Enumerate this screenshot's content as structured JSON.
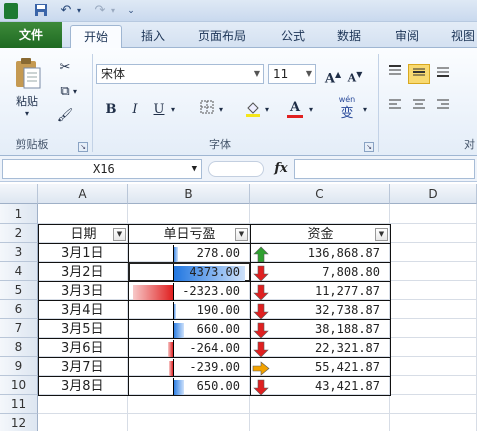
{
  "quick_access": {
    "undo_icon": "undo-icon",
    "redo_icon": "redo-icon",
    "save_icon": "save-icon"
  },
  "tabs": [
    "文件",
    "开始",
    "插入",
    "页面布局",
    "公式",
    "数据",
    "审阅",
    "视图"
  ],
  "ribbon": {
    "clipboard": {
      "paste_label": "粘贴",
      "group_label": "剪贴板"
    },
    "font": {
      "font_name": "宋体",
      "font_size": "11",
      "grow": "A",
      "shrink": "A",
      "bold": "B",
      "italic": "I",
      "underline": "U",
      "wen": "wén",
      "group_label": "字体"
    },
    "alignment": {
      "group_label": "对"
    }
  },
  "formula_bar": {
    "name_box": "X16",
    "fx_label": "fx",
    "formula": ""
  },
  "columns": [
    "A",
    "B",
    "C",
    "D"
  ],
  "rows": [
    "1",
    "2",
    "3",
    "4",
    "5",
    "6",
    "7",
    "8",
    "9",
    "10",
    "11",
    "12"
  ],
  "table": {
    "headers": [
      "日期",
      "单日亏盈",
      "资金"
    ],
    "rows": [
      {
        "date": "3月1日",
        "pl": "278.00",
        "pl_value": 278,
        "funds": "136,868.87",
        "trend": "up"
      },
      {
        "date": "3月2日",
        "pl": "4373.00",
        "pl_value": 4373,
        "funds": "7,808.80",
        "trend": "down"
      },
      {
        "date": "3月3日",
        "pl": "-2323.00",
        "pl_value": -2323,
        "funds": "11,277.87",
        "trend": "down"
      },
      {
        "date": "3月4日",
        "pl": "190.00",
        "pl_value": 190,
        "funds": "32,738.87",
        "trend": "down"
      },
      {
        "date": "3月5日",
        "pl": "660.00",
        "pl_value": 660,
        "funds": "38,188.87",
        "trend": "down"
      },
      {
        "date": "3月6日",
        "pl": "-264.00",
        "pl_value": -264,
        "funds": "22,321.87",
        "trend": "down"
      },
      {
        "date": "3月7日",
        "pl": "-239.00",
        "pl_value": -239,
        "funds": "55,421.87",
        "trend": "flat"
      },
      {
        "date": "3月8日",
        "pl": "650.00",
        "pl_value": 650,
        "funds": "43,421.87",
        "trend": "down"
      }
    ]
  },
  "colors": {
    "up": "#2fa02f",
    "down": "#e02020",
    "flat": "#f2a200",
    "accent": "#1f6a22"
  }
}
